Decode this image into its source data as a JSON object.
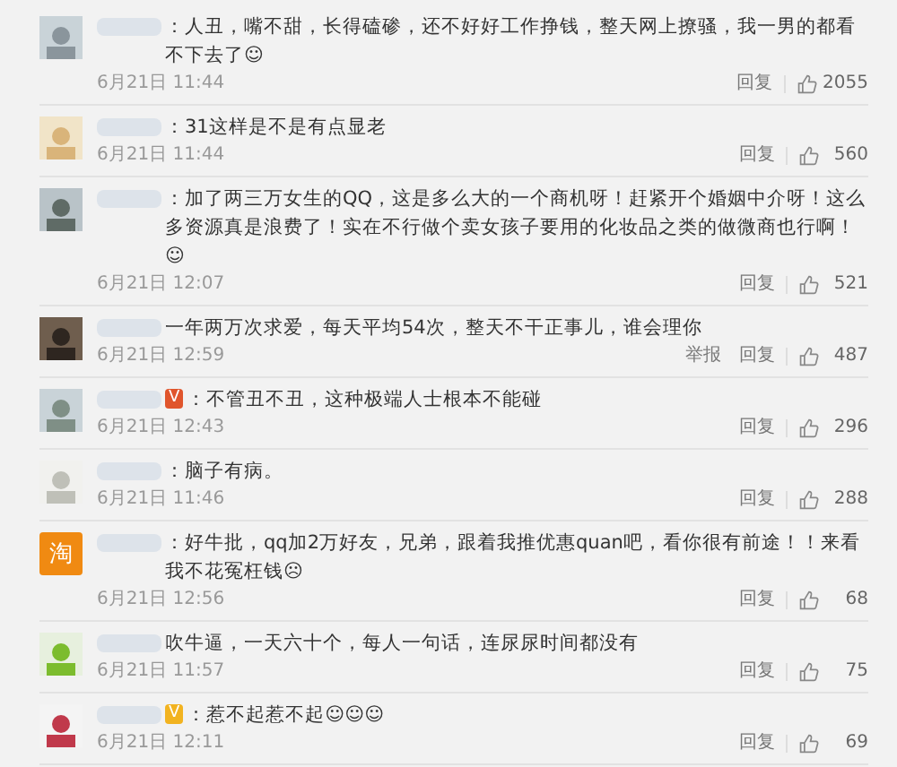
{
  "comments": [
    {
      "avatar": {
        "kind": "picture"
      },
      "text": "：人丑，嘴不甜，长得磕碜，还不好好工作挣钱，整天网上撩骚，我一男的都看不下去了☺",
      "time": "6月21日 11:44",
      "actions": [
        "回复"
      ],
      "likes": "2055"
    },
    {
      "avatar": {
        "kind": "picture"
      },
      "text": "：31这样是不是有点显老",
      "time": "6月21日 11:44",
      "actions": [
        "回复"
      ],
      "likes": "560"
    },
    {
      "avatar": {
        "kind": "picture"
      },
      "text": "：加了两三万女生的QQ，这是多么大的一个商机呀！赶紧开个婚姻中介呀！这么多资源真是浪费了！实在不行做个卖女孩子要用的化妆品之类的做微商也行啊！☺",
      "time": "6月21日 12:07",
      "actions": [
        "回复"
      ],
      "likes": "521"
    },
    {
      "avatar": {
        "kind": "picture"
      },
      "text": "一年两万次求爱，每天平均54次，整天不干正事儿，谁会理你",
      "time": "6月21日 12:59",
      "actions": [
        "举报",
        "回复"
      ],
      "likes": "487"
    },
    {
      "avatar": {
        "kind": "picture"
      },
      "badge": {
        "text": "V",
        "color": "#e0552c"
      },
      "text": "：不管丑不丑，这种极端人士根本不能碰",
      "time": "6月21日 12:43",
      "actions": [
        "回复"
      ],
      "likes": "296"
    },
    {
      "avatar": {
        "kind": "picture"
      },
      "text": "：脑子有病。",
      "time": "6月21日 11:46",
      "actions": [
        "回复"
      ],
      "likes": "288"
    },
    {
      "avatar": {
        "kind": "logo",
        "text": "淘"
      },
      "text": "：好牛批，qq加2万好友，兄弟，跟着我推优惠quan吧，看你很有前途！！来看我不花冤枉钱☹",
      "time": "6月21日 12:56",
      "actions": [
        "回复"
      ],
      "likes": "68"
    },
    {
      "avatar": {
        "kind": "picture"
      },
      "text": "吹牛逼，一天六十个，每人一句话，连尿尿时间都没有",
      "time": "6月21日 11:57",
      "actions": [
        "回复"
      ],
      "likes": "75"
    },
    {
      "avatar": {
        "kind": "picture"
      },
      "badge": {
        "text": "V",
        "color": "#f2b320"
      },
      "text": "：惹不起惹不起☺☺☺",
      "time": "6月21日 12:11",
      "actions": [
        "回复"
      ],
      "likes": "69"
    }
  ]
}
